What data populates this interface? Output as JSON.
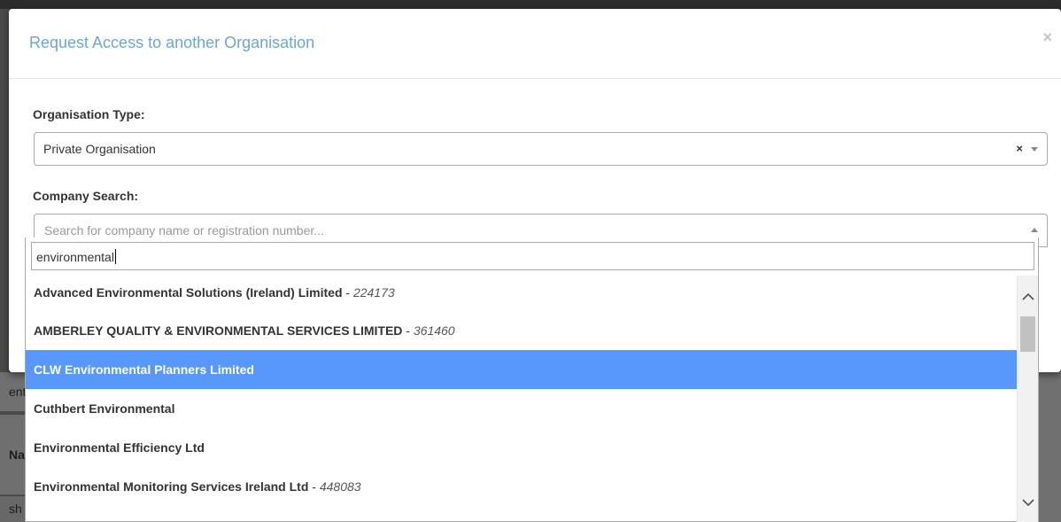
{
  "modal": {
    "title": "Request Access to another Organisation",
    "close_symbol": "×"
  },
  "organisation_type": {
    "label": "Organisation Type:",
    "value": "Private Organisation",
    "clear_symbol": "×"
  },
  "company_search": {
    "label": "Company Search:",
    "placeholder": "Search for company name or registration number...",
    "query": "environmental",
    "results": [
      {
        "name": "Advanced Environmental Solutions (Ireland) Limited",
        "number": "224173"
      },
      {
        "name": "AMBERLEY QUALITY & ENVIRONMENTAL SERVICES LIMITED",
        "number": "361460"
      },
      {
        "name": "CLW Environmental Planners Limited",
        "number": ""
      },
      {
        "name": "Cuthbert Environmental",
        "number": ""
      },
      {
        "name": "Environmental Efficiency Ltd",
        "number": ""
      },
      {
        "name": "Environmental Monitoring Services Ireland Ltd",
        "number": "448083"
      }
    ],
    "highlighted_index": 2,
    "separator": " - "
  },
  "background": {
    "row_a": "ent",
    "row_b": "Nam",
    "row_c": "sh"
  },
  "colors": {
    "title": "#6ea6cf",
    "highlight": "#5897fb"
  },
  "icons": {
    "close": "close-icon",
    "clear": "clear-icon",
    "dropdown_arrow": "chevron-down-icon",
    "scroll_up": "scroll-up-icon",
    "scroll_down": "scroll-down-icon"
  }
}
